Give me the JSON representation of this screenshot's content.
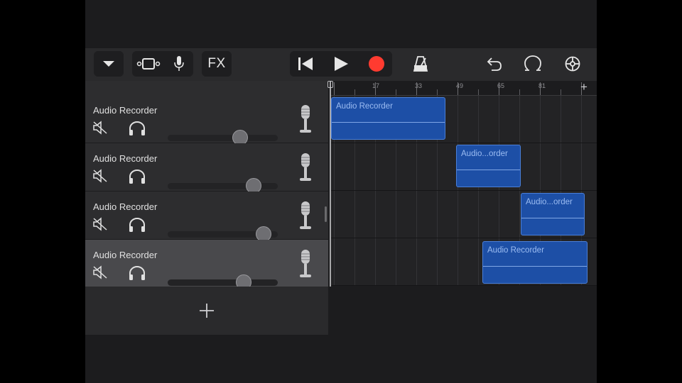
{
  "colors": {
    "record": "#ff3b30",
    "region": "#1d4fa6",
    "region_text": "#9bbcf2"
  },
  "toolbar": {
    "view_menu_icon": "chevron-down-icon",
    "browser_icon": "track-view-icon",
    "mic_icon": "microphone-icon",
    "fx_label": "FX",
    "rewind_icon": "go-to-beginning-icon",
    "play_icon": "play-icon",
    "record_icon": "record-icon",
    "metronome_icon": "metronome-icon",
    "undo_icon": "undo-icon",
    "loop_icon": "loop-browser-icon",
    "settings_icon": "settings-gear-icon"
  },
  "ruler": {
    "labels": [
      "17",
      "33",
      "49",
      "65",
      "81"
    ]
  },
  "tracks": [
    {
      "name": "Audio Recorder",
      "volume": 0.66,
      "selected": false
    },
    {
      "name": "Audio Recorder",
      "volume": 0.78,
      "selected": false
    },
    {
      "name": "Audio Recorder",
      "volume": 0.87,
      "selected": false
    },
    {
      "name": "Audio Recorder",
      "volume": 0.69,
      "selected": true
    }
  ],
  "regions": [
    {
      "label": "Audio Recorder",
      "track": 0
    },
    {
      "label": "Audio...order",
      "track": 1
    },
    {
      "label": "Audio...order",
      "track": 2
    },
    {
      "label": "Audio Recorder",
      "track": 3
    }
  ]
}
